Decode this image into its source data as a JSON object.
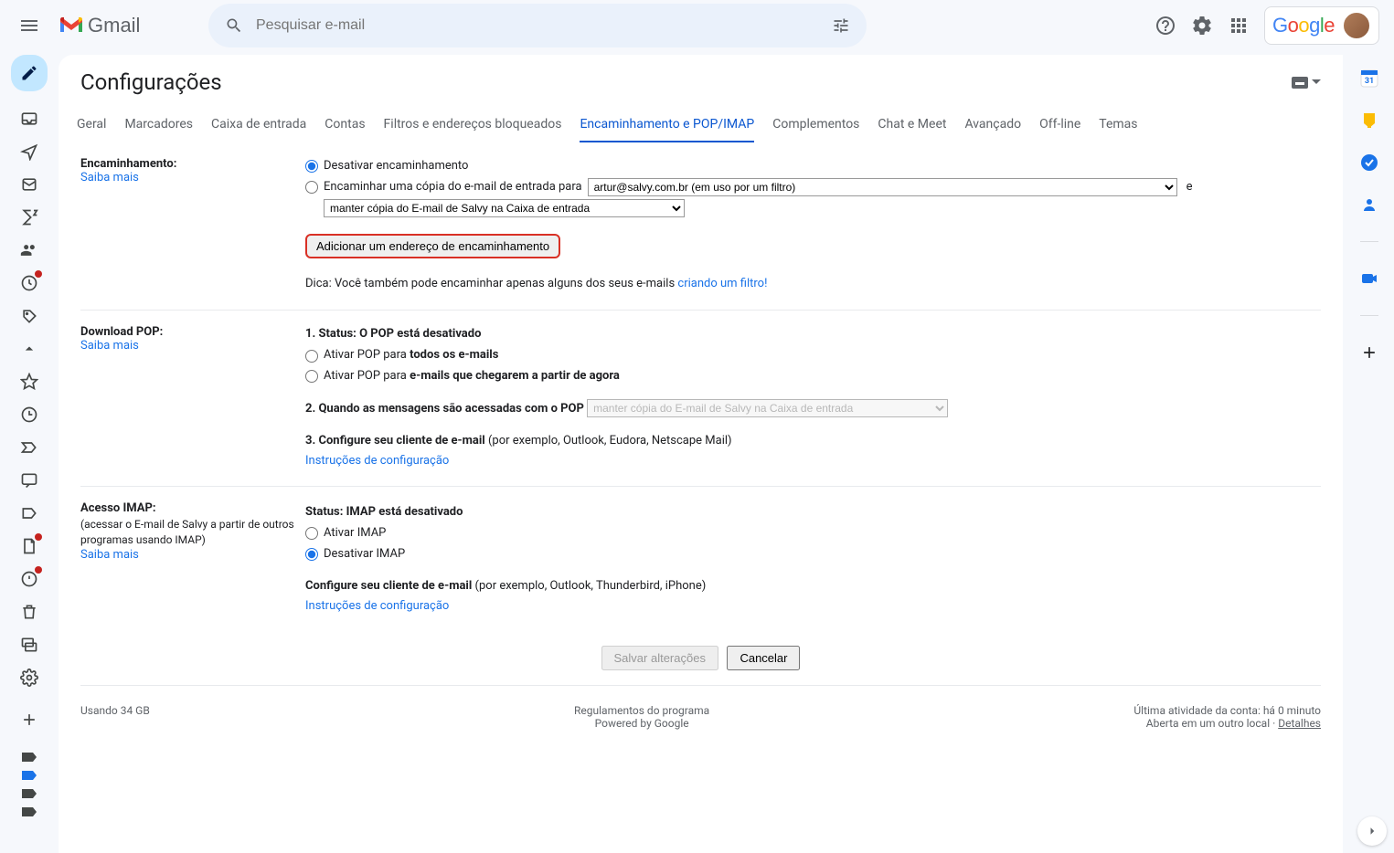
{
  "header": {
    "app_name": "Gmail",
    "search_placeholder": "Pesquisar e-mail"
  },
  "settings_title": "Configurações",
  "tabs": [
    "Geral",
    "Marcadores",
    "Caixa de entrada",
    "Contas",
    "Filtros e endereços bloqueados",
    "Encaminhamento e POP/IMAP",
    "Complementos",
    "Chat e Meet",
    "Avançado",
    "Off-line",
    "Temas"
  ],
  "active_tab_index": 5,
  "forwarding": {
    "label": "Encaminhamento:",
    "learn_more": "Saiba mais",
    "disable_label": "Desativar encaminhamento",
    "forward_copy_label": "Encaminhar uma cópia do e-mail de entrada para",
    "forward_email_option": "artur@salvy.com.br (em uso por um filtro)",
    "and_label": "e",
    "keep_copy_option": "manter cópia do E-mail de Salvy na Caixa de entrada",
    "add_address_button": "Adicionar um endereço de encaminhamento",
    "tip_prefix": "Dica: Você também pode encaminhar apenas alguns dos seus e-mails ",
    "tip_link": "criando um filtro!"
  },
  "pop": {
    "label": "Download POP:",
    "learn_more": "Saiba mais",
    "status_label": "1. Status: ",
    "status_value": "O POP está desativado",
    "enable_all_prefix": "Ativar POP para ",
    "enable_all_bold": "todos os e-mails",
    "enable_now_prefix": "Ativar POP para ",
    "enable_now_bold": "e-mails que chegarem a partir de agora",
    "when_accessed": "2. Quando as mensagens são acessadas com o POP",
    "pop_disabled_select": "manter cópia do E-mail de Salvy na Caixa de entrada",
    "configure_label": "3. Configure seu cliente de e-mail ",
    "configure_example": "(por exemplo, Outlook, Eudora, Netscape Mail)",
    "instructions_link": "Instruções de configuração"
  },
  "imap": {
    "label": "Acesso IMAP:",
    "sub": "(acessar o E-mail de Salvy a partir de outros programas usando IMAP)",
    "learn_more": "Saiba mais",
    "status_label": "Status: ",
    "status_value": "IMAP está desativado",
    "enable_label": "Ativar IMAP",
    "disable_label": "Desativar IMAP",
    "configure_label": "Configure seu cliente de e-mail ",
    "configure_example": "(por exemplo, Outlook, Thunderbird, iPhone)",
    "instructions_link": "Instruções de configuração"
  },
  "buttons": {
    "save": "Salvar alterações",
    "cancel": "Cancelar"
  },
  "footer": {
    "usage": "Usando 34 GB",
    "policies": "Regulamentos do programa",
    "powered": "Powered by Google",
    "activity": "Última atividade da conta: há 0 minuto",
    "open_elsewhere": "Aberta em um outro local · ",
    "details": "Detalhes"
  },
  "input_indicator": "▬"
}
